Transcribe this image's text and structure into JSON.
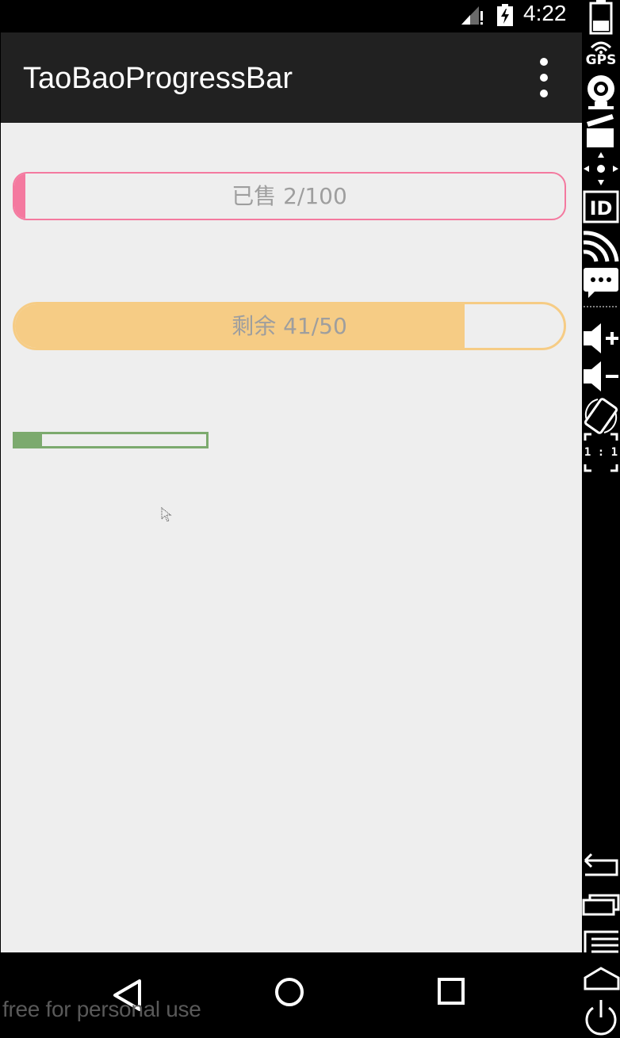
{
  "status_bar": {
    "time": "4:22",
    "signal_icon": "signal-no-data-icon",
    "battery_icon": "battery-charging-icon"
  },
  "app_bar": {
    "title": "TaoBaoProgressBar",
    "menu_icon": "overflow-menu-icon"
  },
  "progress_bars": [
    {
      "label": "已售 2/100",
      "progress": 0.02,
      "color": "#f4799f"
    },
    {
      "label": "剩余 41/50",
      "progress": 0.82,
      "color": "#f6cc85"
    },
    {
      "label": "",
      "progress": 0.14,
      "color": "#7caa6e"
    }
  ],
  "nav_bar": {
    "back_icon": "back-icon",
    "home_icon": "home-icon",
    "recents_icon": "recents-icon"
  },
  "watermark": "free for personal use",
  "emulator_toolbar": {
    "items": [
      "battery-icon",
      "gps-icon",
      "camera-icon",
      "video-clapper-icon",
      "dpad-icon",
      "device-id-icon",
      "network-icon",
      "sms-icon",
      "volume-up-icon",
      "volume-down-icon",
      "rotate-icon",
      "scale-1-to-1-icon",
      "back-icon",
      "home-icon",
      "menu-icon",
      "recents-icon",
      "power-icon"
    ],
    "gps_label": "GPS",
    "scale_label": "1 : 1"
  },
  "colors": {
    "app_bar": "#212121",
    "content_bg": "#eeeeee",
    "pink": "#f4799f",
    "orange": "#f6cc85",
    "green": "#7caa6e"
  }
}
